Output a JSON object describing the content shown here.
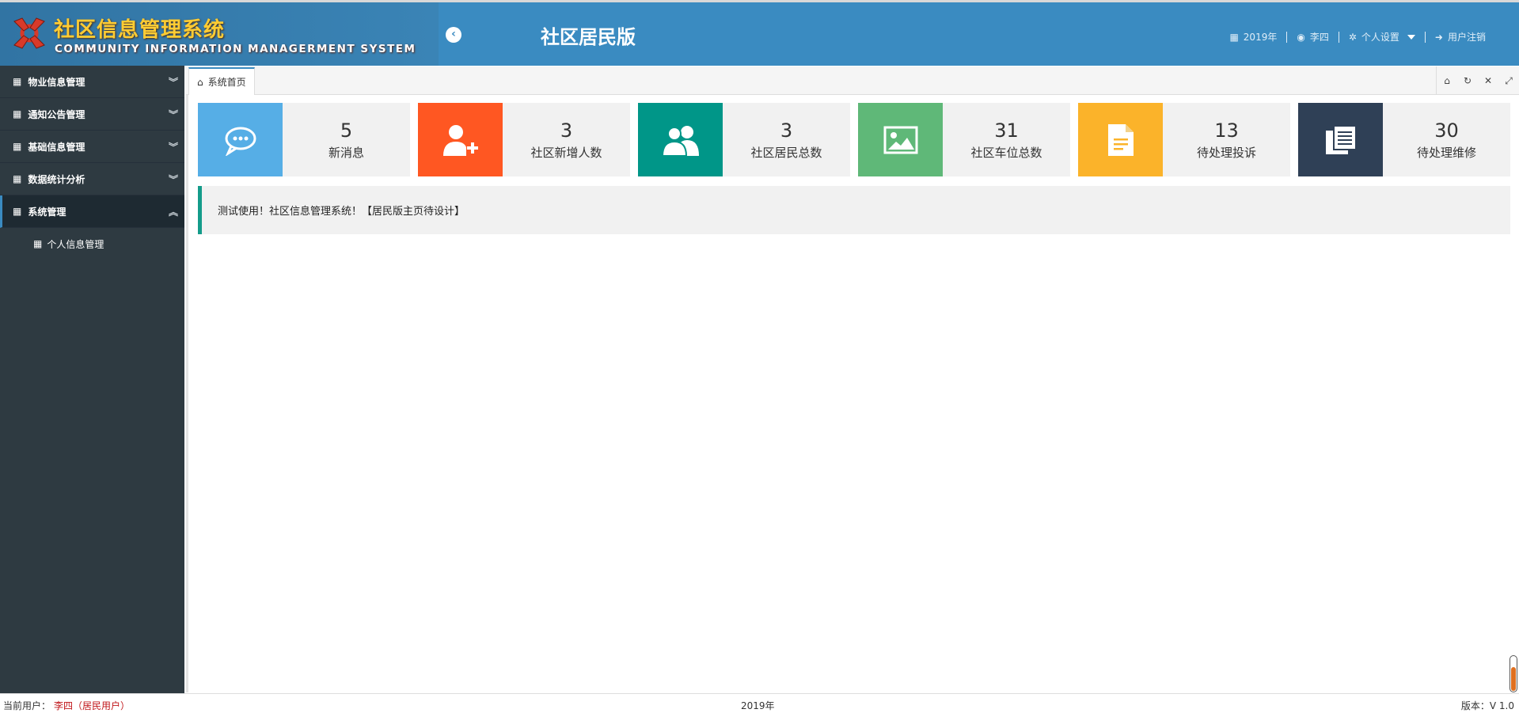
{
  "header": {
    "title": "社区信息管理系统",
    "subtitle": "COMMUNITY INFORMATION MANAGERMENT SYSTEM",
    "edition": "社区居民版",
    "nav": {
      "year": "2019年",
      "user": "李四",
      "settings": "个人设置",
      "logout": "用户注销"
    }
  },
  "sidebar": {
    "items": [
      {
        "label": "物业信息管理",
        "expanded": false
      },
      {
        "label": "通知公告管理",
        "expanded": false
      },
      {
        "label": "基础信息管理",
        "expanded": false
      },
      {
        "label": "数据统计分析",
        "expanded": false
      },
      {
        "label": "系统管理",
        "expanded": true
      }
    ],
    "subitems": [
      {
        "label": "个人信息管理"
      }
    ]
  },
  "tabs": [
    {
      "label": "系统首页",
      "icon": "home-icon"
    }
  ],
  "cards": [
    {
      "value": "5",
      "label": "新消息",
      "color": "#56aee6",
      "icon": "chat-icon"
    },
    {
      "value": "3",
      "label": "社区新增人数",
      "color": "#ff5722",
      "icon": "add-user-icon"
    },
    {
      "value": "3",
      "label": "社区居民总数",
      "color": "#009688",
      "icon": "users-icon"
    },
    {
      "value": "31",
      "label": "社区车位总数",
      "color": "#5fb878",
      "icon": "image-icon"
    },
    {
      "value": "13",
      "label": "待处理投诉",
      "color": "#fbb32a",
      "icon": "document-icon"
    },
    {
      "value": "30",
      "label": "待处理维修",
      "color": "#2f4056",
      "icon": "documents-icon"
    }
  ],
  "notice": "测试使用！社区信息管理系统！【居民版主页待设计】",
  "footer": {
    "current_user_label": "当前用户：",
    "current_user": "李四（居民用户）",
    "year": "2019年",
    "version": "版本：V 1.0"
  }
}
